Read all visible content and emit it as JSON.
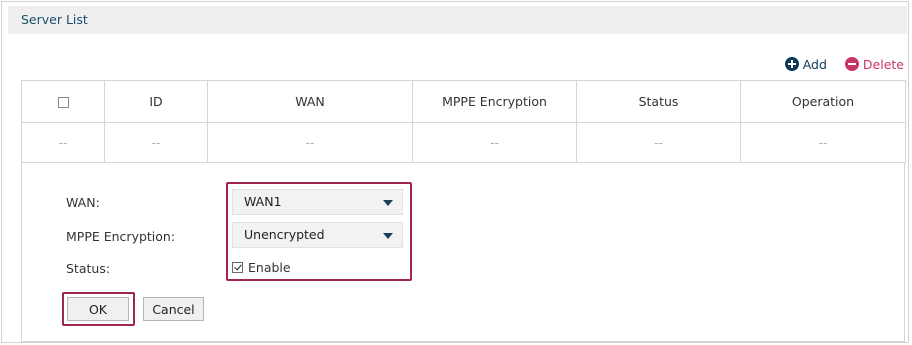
{
  "section": {
    "title": "Server List"
  },
  "toolbar": {
    "add_label": "Add",
    "delete_label": "Delete"
  },
  "table": {
    "columns": [
      "ID",
      "WAN",
      "MPPE Encryption",
      "Status",
      "Operation"
    ],
    "rows": [
      {
        "cells": [
          "--",
          "--",
          "--",
          "--",
          "--",
          "--"
        ]
      }
    ]
  },
  "form": {
    "wan_label": "WAN:",
    "wan_value": "WAN1",
    "mppe_label": "MPPE Encryption:",
    "mppe_value": "Unencrypted",
    "status_label": "Status:",
    "status_checkbox_label": "Enable",
    "status_checked": true,
    "ok_label": "OK",
    "cancel_label": "Cancel"
  },
  "colors": {
    "highlight": "#a0254f",
    "add_icon": "#0d3b57",
    "delete_icon": "#c8356a",
    "title_text": "#1d4e6e"
  },
  "icons": {
    "add": "plus-circle-icon",
    "delete": "minus-circle-icon",
    "dropdown": "chevron-down-icon",
    "checkbox": "check-icon"
  }
}
